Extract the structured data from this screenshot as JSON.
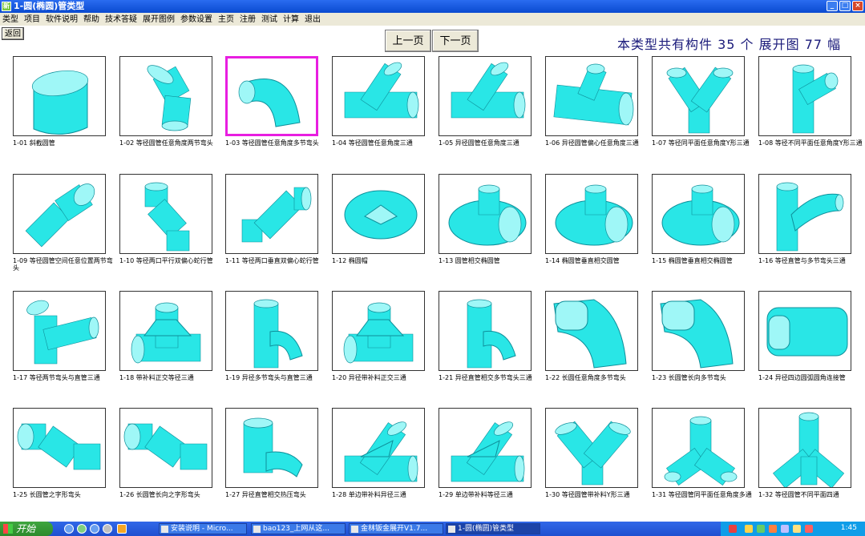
{
  "window": {
    "title": "1-圆(椭圆)管类型",
    "app_icon": "新",
    "controls": {
      "minimize": "_",
      "maximize": "□",
      "close": "×"
    }
  },
  "menu": [
    "类型",
    "项目",
    "软件说明",
    "帮助",
    "技术答疑",
    "展开图例",
    "参数设置",
    "主页",
    "注册",
    "测试",
    "计算",
    "退出"
  ],
  "back_label": "返回",
  "nav": {
    "prev": "上一页",
    "next": "下一页"
  },
  "summary": "本类型共有构件 35 个  展开图 77 幅",
  "accent": "#29e6e6",
  "selection_color": "#e81ee0",
  "items": [
    {
      "label": "1-01 斜截圆管",
      "shape": "cut-cylinder"
    },
    {
      "label": "1-02 等径圆管任意角度两节弯头",
      "shape": "elbow-2"
    },
    {
      "label": "1-03 等径圆管任意角度多节弯头",
      "shape": "elbow-multi",
      "selected": true
    },
    {
      "label": "1-04 等径圆管任意角度三通",
      "shape": "tee-angle"
    },
    {
      "label": "1-05 异径圆管任意角度三通",
      "shape": "tee-angle-small"
    },
    {
      "label": "1-06 异径圆管偏心任意角度三通",
      "shape": "tee-eccentric"
    },
    {
      "label": "1-07 等径同平面任意角度Y形三通",
      "shape": "y-branch"
    },
    {
      "label": "1-08 等径不同平面任意角度Y形三通",
      "shape": "y-branch-3d"
    },
    {
      "label": "1-09 等径圆管空间任意位置两节弯头",
      "shape": "space-elbow"
    },
    {
      "label": "1-10 等径两口平行双偏心蛇行管",
      "shape": "snake"
    },
    {
      "label": "1-11 等径两口垂直双偏心蛇行管",
      "shape": "snake-vertical"
    },
    {
      "label": "1-12 椭圆帽",
      "shape": "ellipse-cap"
    },
    {
      "label": "1-13 圆管相交椭圆管",
      "shape": "ellipse-tee"
    },
    {
      "label": "1-14 椭圆管垂直相交圆管",
      "shape": "ellipse-tee-2"
    },
    {
      "label": "1-15 椭圆管垂直相交椭圆管",
      "shape": "ellipse-tee-3"
    },
    {
      "label": "1-16 等径直管与多节弯头三通",
      "shape": "pipe-elbow-tee"
    },
    {
      "label": "1-17 等径两节弯头与直管三通",
      "shape": "elbow-tee"
    },
    {
      "label": "1-18 带补料正交等径三通",
      "shape": "reinforced-tee"
    },
    {
      "label": "1-19 异径多节弯头与直管三通",
      "shape": "elbow-tee-2"
    },
    {
      "label": "1-20 异径带补料正交三通",
      "shape": "reinforced-tee-2"
    },
    {
      "label": "1-21 异径直管相交多节弯头三通",
      "shape": "elbow-tee-3"
    },
    {
      "label": "1-22 长圆任意角度多节弯头",
      "shape": "oblong-elbow"
    },
    {
      "label": "1-23 长圆管长向多节弯头",
      "shape": "oblong-elbow-2"
    },
    {
      "label": "1-24 异径四边圆弧圆角连接管",
      "shape": "rounded-box"
    },
    {
      "label": "1-25 长圆管之字形弯头",
      "shape": "zigzag"
    },
    {
      "label": "1-26 长圆管长向之字形弯头",
      "shape": "zigzag-2"
    },
    {
      "label": "1-27 异径直管相交热压弯头",
      "shape": "hot-elbow"
    },
    {
      "label": "1-28 单边带补料异径三通",
      "shape": "tee-side"
    },
    {
      "label": "1-29 单边带补料等径三通",
      "shape": "tee-side-2"
    },
    {
      "label": "1-30 等径圆管带补料Y形三通",
      "shape": "y-reinforced"
    },
    {
      "label": "1-31 等径圆管同平面任意角度多通",
      "shape": "multi-way"
    },
    {
      "label": "1-32 等径圆管不同平面四通",
      "shape": "four-way"
    }
  ],
  "taskbar": {
    "start": "开始",
    "tasks": [
      "安装说明 - Micro...",
      "bao123_上网从这...",
      "金林钣金展开V1.7...",
      "1-圆(椭圆)管类型"
    ],
    "clock": "1:45"
  }
}
